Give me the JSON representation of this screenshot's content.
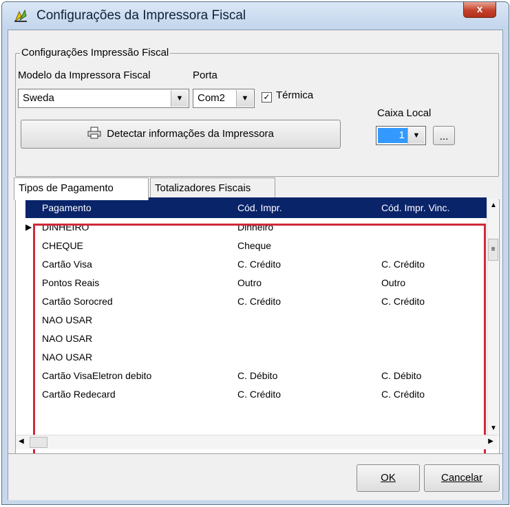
{
  "window": {
    "title": "Configurações da Impressora Fiscal",
    "close_label": "x"
  },
  "fiscal_group": {
    "legend": "Configurações Impressão Fiscal",
    "model_label": "Modelo da Impressora Fiscal",
    "model_value": "Sweda",
    "port_label": "Porta",
    "port_value": "Com2",
    "thermal_label": "Térmica",
    "thermal_checked": true,
    "detect_button": "Detectar informações da Impressora",
    "caixa_label": "Caixa Local",
    "caixa_value": "1",
    "ellipsis_button": "..."
  },
  "tabs": [
    {
      "label": "Tipos de Pagamento",
      "active": true
    },
    {
      "label": "Totalizadores Fiscais",
      "active": false
    }
  ],
  "grid": {
    "columns": [
      "Pagamento",
      "Cód. Impr.",
      "Cód. Impr. Vinc."
    ],
    "rows": [
      {
        "pagamento": "DINHEIRO",
        "cod": "Dinheiro",
        "vinc": ""
      },
      {
        "pagamento": "CHEQUE",
        "cod": "Cheque",
        "vinc": ""
      },
      {
        "pagamento": "Cartão Visa",
        "cod": "C. Crédito",
        "vinc": "C. Crédito"
      },
      {
        "pagamento": "Pontos Reais",
        "cod": "Outro",
        "vinc": "Outro"
      },
      {
        "pagamento": "Cartão Sorocred",
        "cod": "C. Crédito",
        "vinc": "C. Crédito"
      },
      {
        "pagamento": "NAO USAR",
        "cod": "",
        "vinc": ""
      },
      {
        "pagamento": "NAO USAR",
        "cod": "",
        "vinc": ""
      },
      {
        "pagamento": "NAO USAR",
        "cod": "",
        "vinc": ""
      },
      {
        "pagamento": "Cartão VisaEletron debito",
        "cod": "C. Débito",
        "vinc": "C. Débito"
      },
      {
        "pagamento": "Cartão Redecard",
        "cod": "C. Crédito",
        "vinc": "C. Crédito"
      }
    ],
    "current_row_indicator": "▶"
  },
  "footer": {
    "ok_label": "OK",
    "cancel_label": "Cancelar"
  },
  "colors": {
    "grid_header": "#0a246a",
    "highlight_frame": "#d1283a",
    "caixa_selection": "#3399ff"
  }
}
